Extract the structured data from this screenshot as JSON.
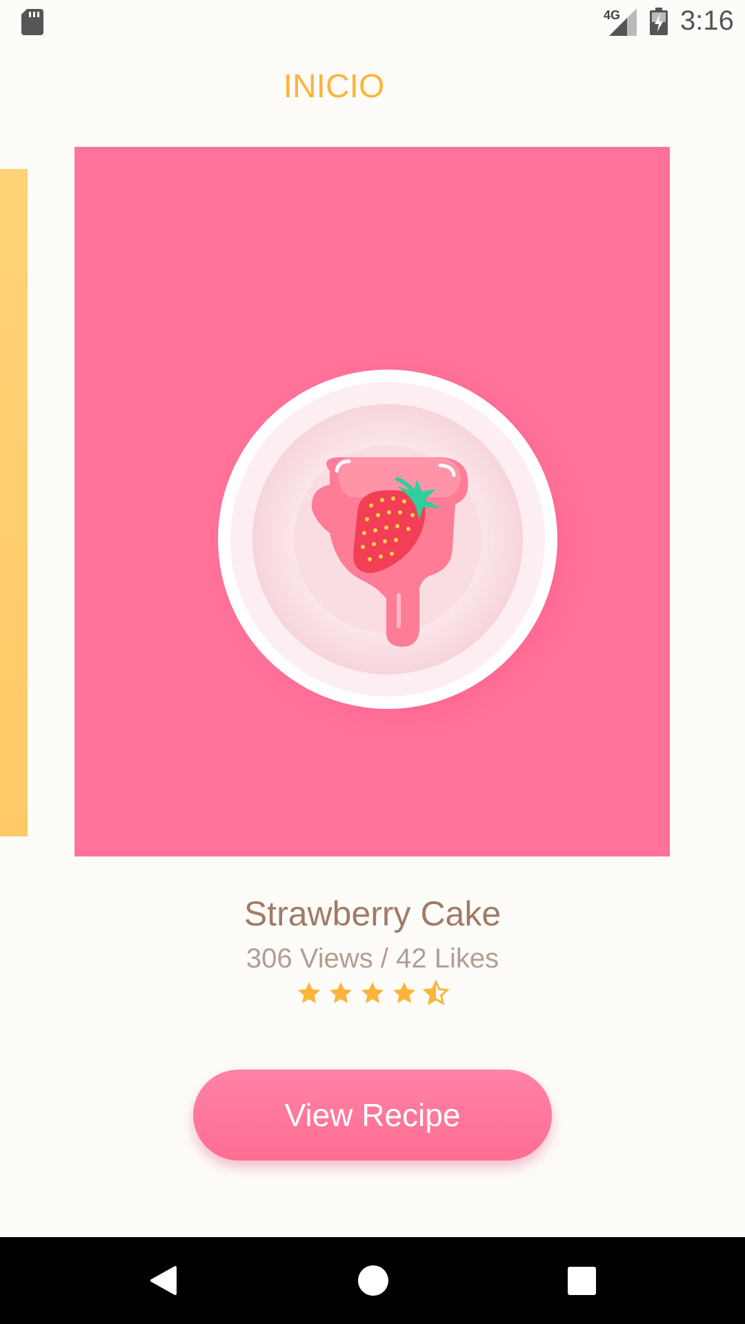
{
  "status_bar": {
    "network_label": "4G",
    "time": "3:16",
    "icons": [
      "sd-card-icon",
      "signal-icon",
      "battery-charging-icon"
    ]
  },
  "header": {
    "title": "INICIO"
  },
  "carousel": {
    "current_card": {
      "image": "strawberry-cake-illustration",
      "background_color": "#ff7299"
    },
    "previous_card_color": "#ffcf6f"
  },
  "recipe": {
    "title": "Strawberry Cake",
    "stats": "306 Views / 42 Likes",
    "rating": 4.5,
    "rating_max": 5
  },
  "actions": {
    "view_recipe_label": "View Recipe"
  },
  "nav_bar": {
    "icons": [
      "back-icon",
      "home-icon",
      "recents-icon"
    ]
  },
  "colors": {
    "accent": "#fdb43a",
    "pink": "#ff7299",
    "title_brown": "#a07a68",
    "star": "#fdb43a"
  }
}
